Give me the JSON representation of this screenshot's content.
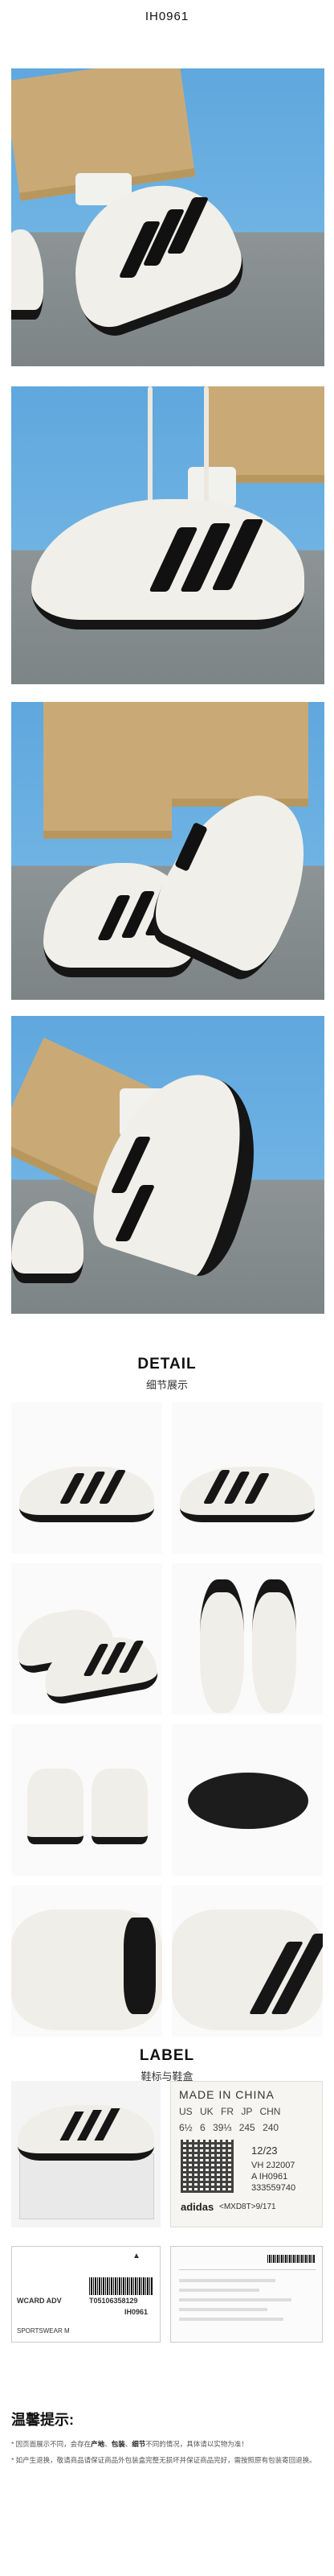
{
  "header": {
    "product_code": "IH0961"
  },
  "detail": {
    "title_en": "DETAIL",
    "title_cn": "细节展示"
  },
  "label_section": {
    "title_en": "LABEL",
    "title_cn": "鞋标与鞋盒"
  },
  "shoe_label": {
    "made_in": "MADE IN CHINA",
    "size_headers": "US UK FR JP CHN",
    "size_values": "6½ 6 39⅓ 245 240",
    "date": "12/23",
    "vh": "VH 2J2007",
    "article": "A IH0961",
    "code1": "333559740",
    "brand": "adidas",
    "code2": "<MXD8T>9/171"
  },
  "box_label": {
    "model": "WCARD ADV",
    "article": "IH0961",
    "barcode_number": "T05106358129",
    "category": "SPORTSWEAR M"
  },
  "notice": {
    "title": "温馨提示:",
    "line1_pre": "* 因页面展示不同，会存在",
    "line1_b1": "产地",
    "line1_sep1": "、",
    "line1_b2": "包装",
    "line1_sep2": "、",
    "line1_b3": "细节",
    "line1_post": "不同的情况，具体请以实物为准！",
    "line2": "* 如产生退换，敬请商品请保证商品外包装盒完整无损坏并保证商品完好，需按照原有包装寄回退换。"
  },
  "colors": {
    "sky": "#6fb3e3",
    "pants": "#c9aa76",
    "shoe_white": "#f1efe9",
    "stripe_black": "#111111"
  }
}
